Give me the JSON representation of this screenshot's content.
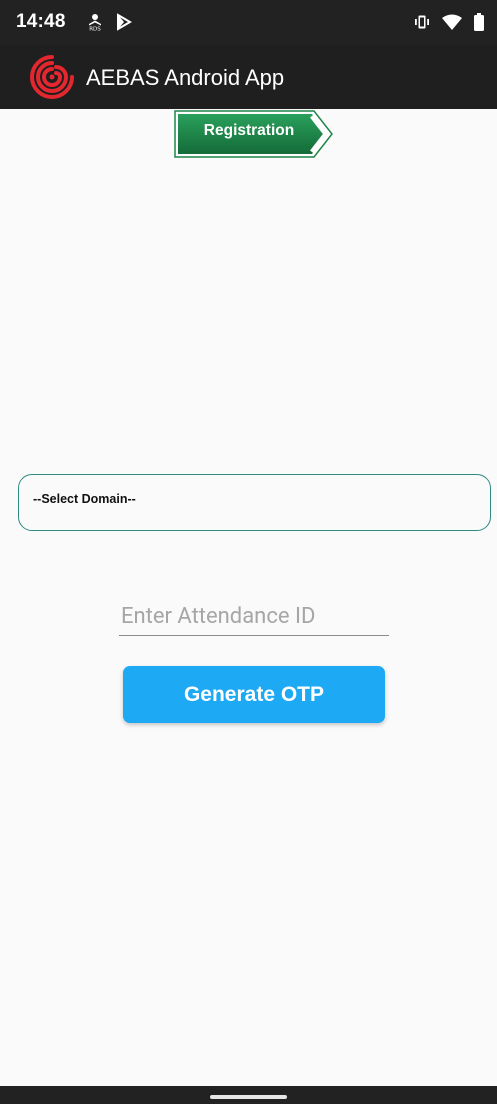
{
  "status_bar": {
    "time": "14:48",
    "left_icons": [
      "rds-person-icon",
      "play-icon"
    ],
    "right_icons": [
      "vibrate-icon",
      "wifi-icon",
      "battery-icon"
    ]
  },
  "app_bar": {
    "title": "AEBAS Android App",
    "logo_icon": "fingerprint-spiral-logo"
  },
  "registration": {
    "label": "Registration"
  },
  "domain_select": {
    "selected": "--Select Domain--"
  },
  "attendance": {
    "placeholder": "Enter Attendance ID",
    "value": ""
  },
  "otp_button": {
    "label": "Generate OTP"
  },
  "colors": {
    "app_bar": "#1f1f1f",
    "status_bar": "#222222",
    "background": "#fafafa",
    "badge_green": "#1e8449",
    "select_border": "#2e8b80",
    "button_blue": "#1ea9f5",
    "logo_red": "#e3272f"
  }
}
